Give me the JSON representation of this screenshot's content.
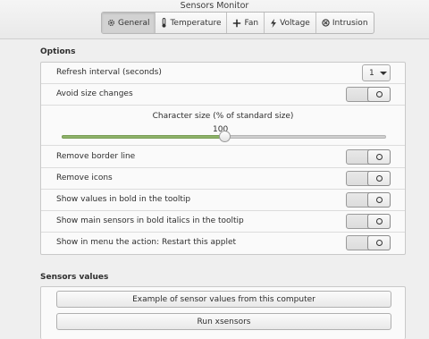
{
  "window": {
    "title": "Sensors Monitor"
  },
  "tabs": [
    {
      "label": "General",
      "icon": "gear-icon",
      "active": true
    },
    {
      "label": "Temperature",
      "icon": "thermometer-icon",
      "active": false
    },
    {
      "label": "Fan",
      "icon": "fan-icon",
      "active": false
    },
    {
      "label": "Voltage",
      "icon": "lightning-icon",
      "active": false
    },
    {
      "label": "Intrusion",
      "icon": "intrusion-icon",
      "active": false
    }
  ],
  "options": {
    "title": "Options",
    "refresh_interval": {
      "label": "Refresh interval (seconds)",
      "value": "1"
    },
    "avoid_size_changes": {
      "label": "Avoid size changes",
      "on": false
    },
    "character_size": {
      "caption": "Character size (% of standard size)",
      "value": "100",
      "fraction": 0.5
    },
    "toggles": [
      {
        "label": "Remove border line",
        "on": false
      },
      {
        "label": "Remove icons",
        "on": false
      },
      {
        "label": "Show values in bold in the tooltip",
        "on": false
      },
      {
        "label": "Show main sensors in bold italics in the tooltip",
        "on": false
      },
      {
        "label": "Show in menu the action: Restart this applet",
        "on": false
      }
    ]
  },
  "sensors_values": {
    "title": "Sensors values",
    "example_button": "Example of sensor values from this computer",
    "run_button": "Run xsensors"
  },
  "colors": {
    "slider_fill": "#8fb36a",
    "active_tab": "#d2d2d2"
  }
}
